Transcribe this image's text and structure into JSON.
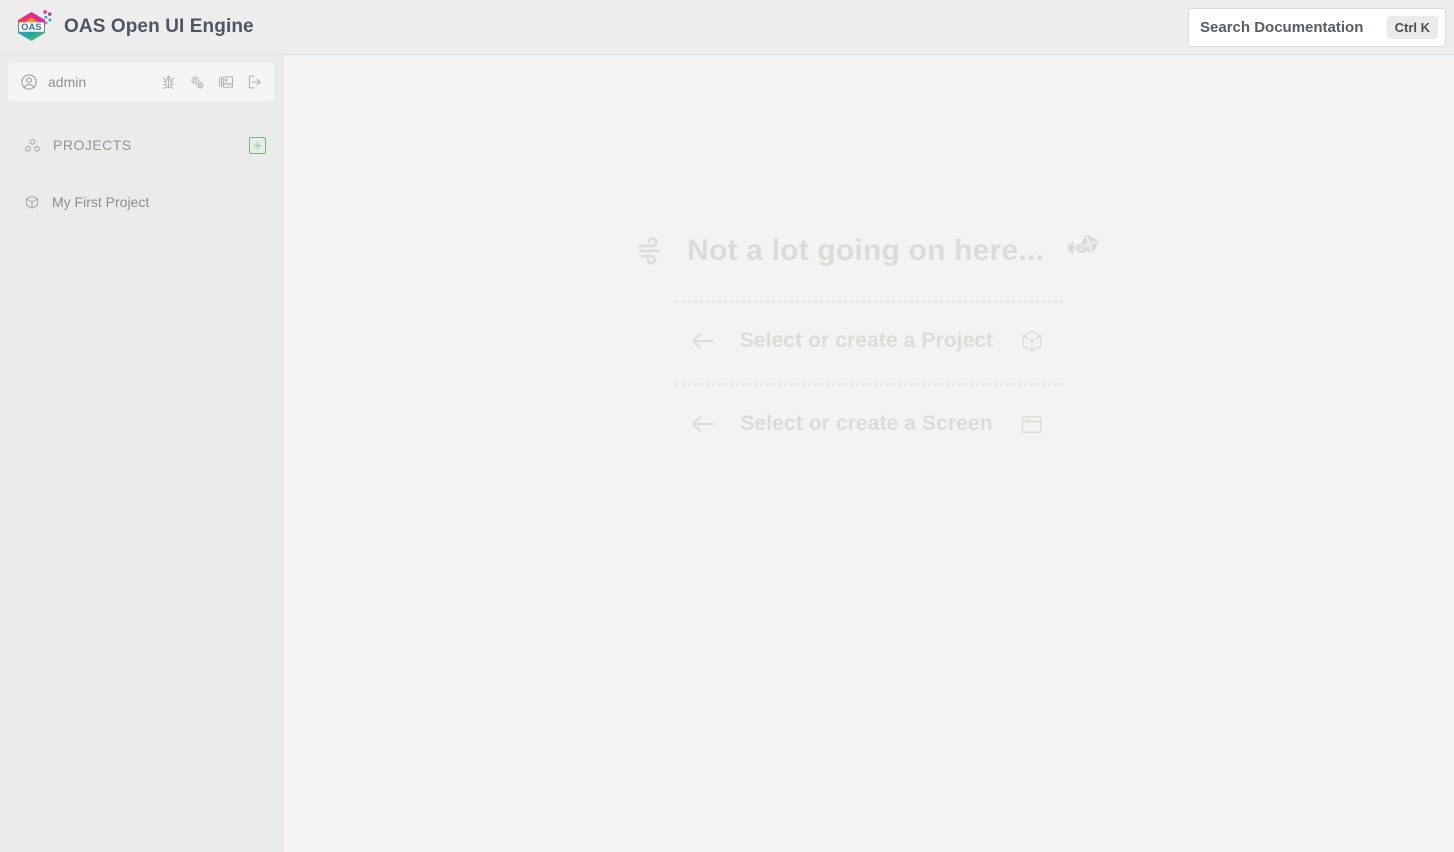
{
  "header": {
    "logo_icon": "oas-hexagon-logo",
    "title": "OAS Open UI Engine",
    "search": {
      "placeholder": "Search Documentation",
      "shortcut": "Ctrl K",
      "value": ""
    }
  },
  "sidebar": {
    "user": {
      "avatar_icon": "user-circle-icon",
      "name": "admin",
      "actions": [
        {
          "icon": "bug-icon",
          "label": "Debug"
        },
        {
          "icon": "gears-icon",
          "label": "Settings"
        },
        {
          "icon": "media-gallery-icon",
          "label": "Media"
        },
        {
          "icon": "logout-icon",
          "label": "Logout"
        }
      ]
    },
    "projects_section": {
      "icon": "boxes-icon",
      "label": "PROJECTS",
      "add_icon": "plus-square-icon",
      "add_label": "Add Project"
    },
    "projects": [
      {
        "icon": "cube-icon",
        "label": "My First Project"
      }
    ]
  },
  "main": {
    "empty_state": {
      "headline": {
        "left_icon": "wind-icon",
        "text": "Not a lot going on here...",
        "right_icon": "kite-icon"
      },
      "rows": [
        {
          "arrow_icon": "arrow-left-icon",
          "text": "Select or create a Project",
          "trail_icon": "cube-icon"
        },
        {
          "arrow_icon": "arrow-left-icon",
          "text": "Select or create a Screen",
          "trail_icon": "window-icon"
        }
      ]
    }
  },
  "colors": {
    "header_bg": "#ededed",
    "sidebar_bg": "#ebebeb",
    "main_bg": "#f4f3f1",
    "brand_title": "#4e5663",
    "muted_text": "#8d8d8d",
    "ghost_text": "#dcdbd8",
    "accent_green": "#6cbf73"
  }
}
